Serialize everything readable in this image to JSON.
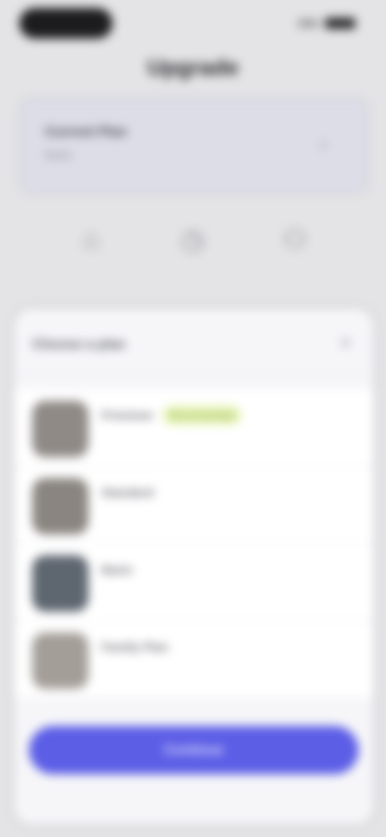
{
  "status_bar": {
    "time": "",
    "signal_icon": "signal-icon",
    "battery_icon": "battery-icon"
  },
  "header": {
    "title": "Upgrade"
  },
  "plan_card": {
    "name": "Current Plan",
    "subtitle": "Basic",
    "chevron_icon": "chevron-right-icon"
  },
  "tabs": [
    {
      "icon": "ticket-icon",
      "glyph": "⌂",
      "label": ""
    },
    {
      "icon": "clock-icon",
      "glyph": "◷",
      "label": ""
    },
    {
      "icon": "user-icon",
      "glyph": "⚇",
      "label": ""
    }
  ],
  "sheet": {
    "title": "Choose a plan",
    "close_icon": "close-icon",
    "items": [
      {
        "title": "Premium",
        "subtitle": "",
        "badge": "Recommended",
        "thumb_color": "#8f8a86"
      },
      {
        "title": "Standard",
        "subtitle": "",
        "badge": "",
        "thumb_color": "#8a8580"
      },
      {
        "title": "Basic",
        "subtitle": "",
        "badge": "",
        "thumb_color": "#5e6670"
      },
      {
        "title": "Family Plan",
        "subtitle": "",
        "badge": "",
        "thumb_color": "#a49e99"
      }
    ],
    "cta_label": "Continue"
  },
  "colors": {
    "accent": "#5c5ee6",
    "badge_bg": "#e8f6b8",
    "sheet_bg": "#f6f6f9",
    "page_bg": "#e4e4e6"
  }
}
